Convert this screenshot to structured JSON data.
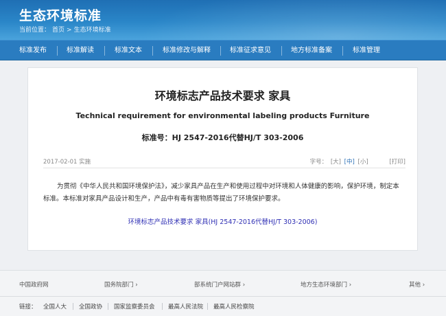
{
  "header": {
    "site_title": "生态环境标准",
    "breadcrumb": {
      "prefix": "当前位置：",
      "home": "首页",
      "sep": ">",
      "current": "生态环境标准"
    }
  },
  "nav": {
    "items": [
      "标准发布",
      "标准解读",
      "标准文本",
      "标准修改与解释",
      "标准征求意见",
      "地方标准备案",
      "标准管理"
    ]
  },
  "document": {
    "title": "环境标志产品技术要求 家具",
    "subtitle": "Technical requirement for environmental labeling products Furniture",
    "number": "标准号：HJ 2547-2016代替HJ/T 303-2006",
    "date": "2017-02-01 实施",
    "font_size": {
      "label": "字号：",
      "large": "[大]",
      "medium": "[中]",
      "small": "[小]",
      "print": "[打印]"
    },
    "paragraph": "为贯彻《中华人民共和国环境保护法》，减少家具产品在生产和使用过程中对环境和人体健康的影响，保护环境，制定本标准。本标准对家具产品设计和生产，产品中有毒有害物质等提出了环境保护要求。",
    "link": "环境标志产品技术要求 家具(HJ 2547-2016代替HJ/T 303-2006)"
  },
  "footer": {
    "row1": [
      "中国政府网",
      "国务院部门",
      "部系统门户网站群",
      "地方生态环境部门",
      "其他"
    ],
    "links_label": "链接：",
    "links": [
      "全国人大",
      "全国政协",
      "国家监察委员会",
      "最高人民法院",
      "最高人民检察院"
    ]
  },
  "colors": {
    "header_blue": "#2a86c8",
    "nav_blue": "#2a7cc0",
    "link_blue": "#2f2fb4"
  }
}
